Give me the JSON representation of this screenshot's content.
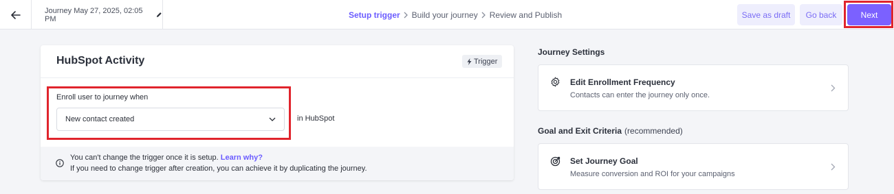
{
  "header": {
    "journey_name": "Journey May 27, 2025, 02:05 PM",
    "icons": {
      "back": "arrow-left-icon",
      "edit": "pencil-icon"
    },
    "steps": [
      {
        "label": "Setup trigger",
        "active": true
      },
      {
        "label": "Build your journey",
        "active": false
      },
      {
        "label": "Review and Publish",
        "active": false
      }
    ],
    "save_draft_label": "Save as draft",
    "go_back_label": "Go back",
    "next_label": "Next"
  },
  "trigger_card": {
    "title": "HubSpot Activity",
    "badge_label": "Trigger",
    "badge_icon": "lightning-icon",
    "enroll_label": "Enroll user to journey when",
    "select_value": "New contact created",
    "suffix": "in HubSpot",
    "info_line1": "You can't change the trigger once it is setup.",
    "info_link": "Learn why?",
    "info_line2": "If you need to change trigger after creation, you can achieve it by duplicating the journey."
  },
  "journey_settings": {
    "title": "Journey Settings",
    "items": [
      {
        "title": "Edit Enrollment Frequency",
        "desc": "Contacts can enter the journey only once.",
        "icon": "gear-icon"
      }
    ]
  },
  "goal_section": {
    "title": "Goal and Exit Criteria",
    "recommended": "(recommended)",
    "items": [
      {
        "title": "Set Journey Goal",
        "desc": "Measure conversion and ROI for your campaigns",
        "icon": "target-icon"
      }
    ]
  },
  "colors": {
    "accent": "#7b61ff",
    "accent_light": "#eeeefd",
    "highlight": "#e0242c",
    "background": "#f4f5f8"
  }
}
